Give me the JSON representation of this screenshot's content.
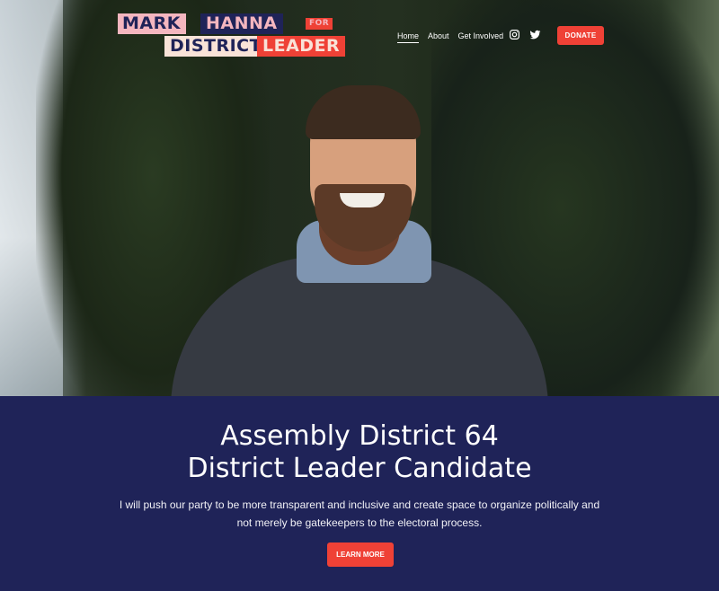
{
  "logo": {
    "line1_a": "MARK",
    "line1_b": "HANNA",
    "line1_c": "FOR",
    "line2_a": "DISTRICT",
    "line2_b": "LEADER"
  },
  "nav": {
    "items": [
      {
        "label": "Home",
        "active": true
      },
      {
        "label": "About",
        "active": false
      },
      {
        "label": "Get Involved",
        "active": false
      }
    ],
    "social_icons": [
      "instagram-icon",
      "twitter-icon"
    ],
    "donate_label": "DONATE"
  },
  "hero": {
    "image": "photo-of-smiling-man-in-front-of-trees"
  },
  "panel": {
    "heading_line1": "Assembly District 64",
    "heading_line2": "District Leader Candidate",
    "body": "I will push our party to be more transparent and inclusive and create space to organize politically and not merely be gatekeepers to the electoral process.",
    "cta_label": "LEARN MORE"
  },
  "colors": {
    "navy": "#1f2358",
    "accent_red": "#ef4136",
    "pink": "#f4b6bf",
    "cream": "#f9e3d8"
  }
}
